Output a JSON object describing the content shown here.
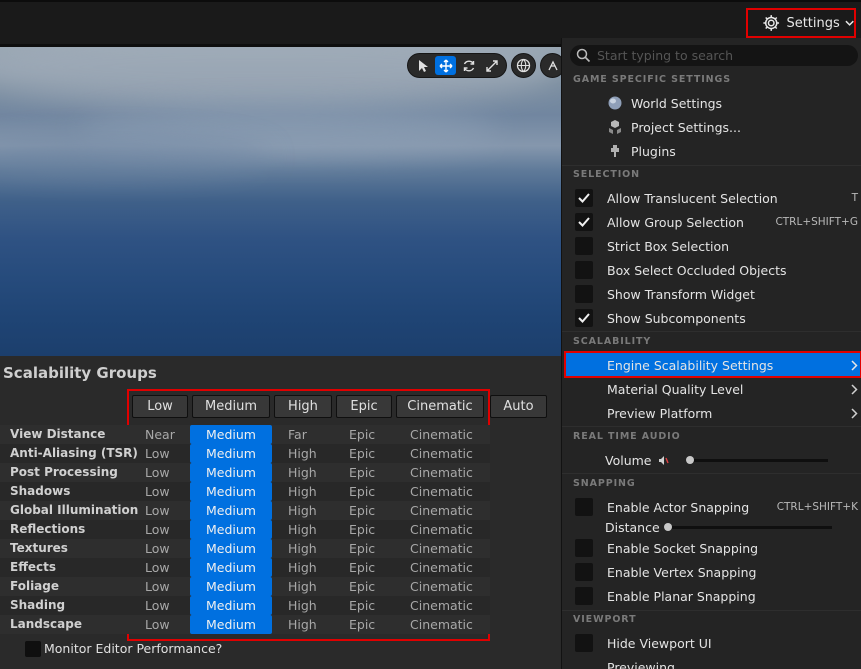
{
  "toolbar": {
    "settings_label": "Settings"
  },
  "scalability": {
    "title": "Scalability Groups",
    "levels": [
      "Low",
      "Medium",
      "High",
      "Epic",
      "Cinematic"
    ],
    "auto_label": "Auto",
    "rows": [
      {
        "name": "View Distance",
        "cells": [
          "Near",
          "Medium",
          "Far",
          "Epic",
          "Cinematic"
        ]
      },
      {
        "name": "Anti-Aliasing (TSR)",
        "cells": [
          "Low",
          "Medium",
          "High",
          "Epic",
          "Cinematic"
        ]
      },
      {
        "name": "Post Processing",
        "cells": [
          "Low",
          "Medium",
          "High",
          "Epic",
          "Cinematic"
        ]
      },
      {
        "name": "Shadows",
        "cells": [
          "Low",
          "Medium",
          "High",
          "Epic",
          "Cinematic"
        ]
      },
      {
        "name": "Global Illumination",
        "cells": [
          "Low",
          "Medium",
          "High",
          "Epic",
          "Cinematic"
        ]
      },
      {
        "name": "Reflections",
        "cells": [
          "Low",
          "Medium",
          "High",
          "Epic",
          "Cinematic"
        ]
      },
      {
        "name": "Textures",
        "cells": [
          "Low",
          "Medium",
          "High",
          "Epic",
          "Cinematic"
        ]
      },
      {
        "name": "Effects",
        "cells": [
          "Low",
          "Medium",
          "High",
          "Epic",
          "Cinematic"
        ]
      },
      {
        "name": "Foliage",
        "cells": [
          "Low",
          "Medium",
          "High",
          "Epic",
          "Cinematic"
        ]
      },
      {
        "name": "Shading",
        "cells": [
          "Low",
          "Medium",
          "High",
          "Epic",
          "Cinematic"
        ]
      },
      {
        "name": "Landscape",
        "cells": [
          "Low",
          "Medium",
          "High",
          "Epic",
          "Cinematic"
        ]
      }
    ],
    "selected_level": "Medium",
    "monitor_label": "Monitor Editor Performance?"
  },
  "menu": {
    "search_placeholder": "Start typing to search",
    "sections": {
      "game": "GAME SPECIFIC SETTINGS",
      "selection": "SELECTION",
      "scalability": "SCALABILITY",
      "audio": "REAL TIME AUDIO",
      "snapping": "SNAPPING",
      "viewport": "VIEWPORT"
    },
    "game_items": [
      "World Settings",
      "Project Settings...",
      "Plugins"
    ],
    "selection_items": [
      {
        "label": "Allow Translucent Selection",
        "checked": true,
        "shortcut": "T"
      },
      {
        "label": "Allow Group Selection",
        "checked": true,
        "shortcut": "CTRL+SHIFT+G"
      },
      {
        "label": "Strict Box Selection",
        "checked": false,
        "shortcut": ""
      },
      {
        "label": "Box Select Occluded Objects",
        "checked": false,
        "shortcut": ""
      },
      {
        "label": "Show Transform Widget",
        "checked": false,
        "shortcut": ""
      },
      {
        "label": "Show Subcomponents",
        "checked": true,
        "shortcut": ""
      }
    ],
    "scalability_items": [
      "Engine Scalability Settings",
      "Material Quality Level",
      "Preview Platform"
    ],
    "volume_label": "Volume",
    "volume_level": 0,
    "snapping": {
      "actor_label": "Enable Actor Snapping",
      "actor_shortcut": "CTRL+SHIFT+K",
      "distance_label": "Distance",
      "distance_level": 0,
      "items": [
        "Enable Socket Snapping",
        "Enable Vertex Snapping",
        "Enable Planar Snapping"
      ]
    },
    "viewport_items": [
      "Hide Viewport UI",
      "Previewing"
    ]
  },
  "colors": {
    "accent": "#0070e0",
    "highlight": "#e00000"
  }
}
